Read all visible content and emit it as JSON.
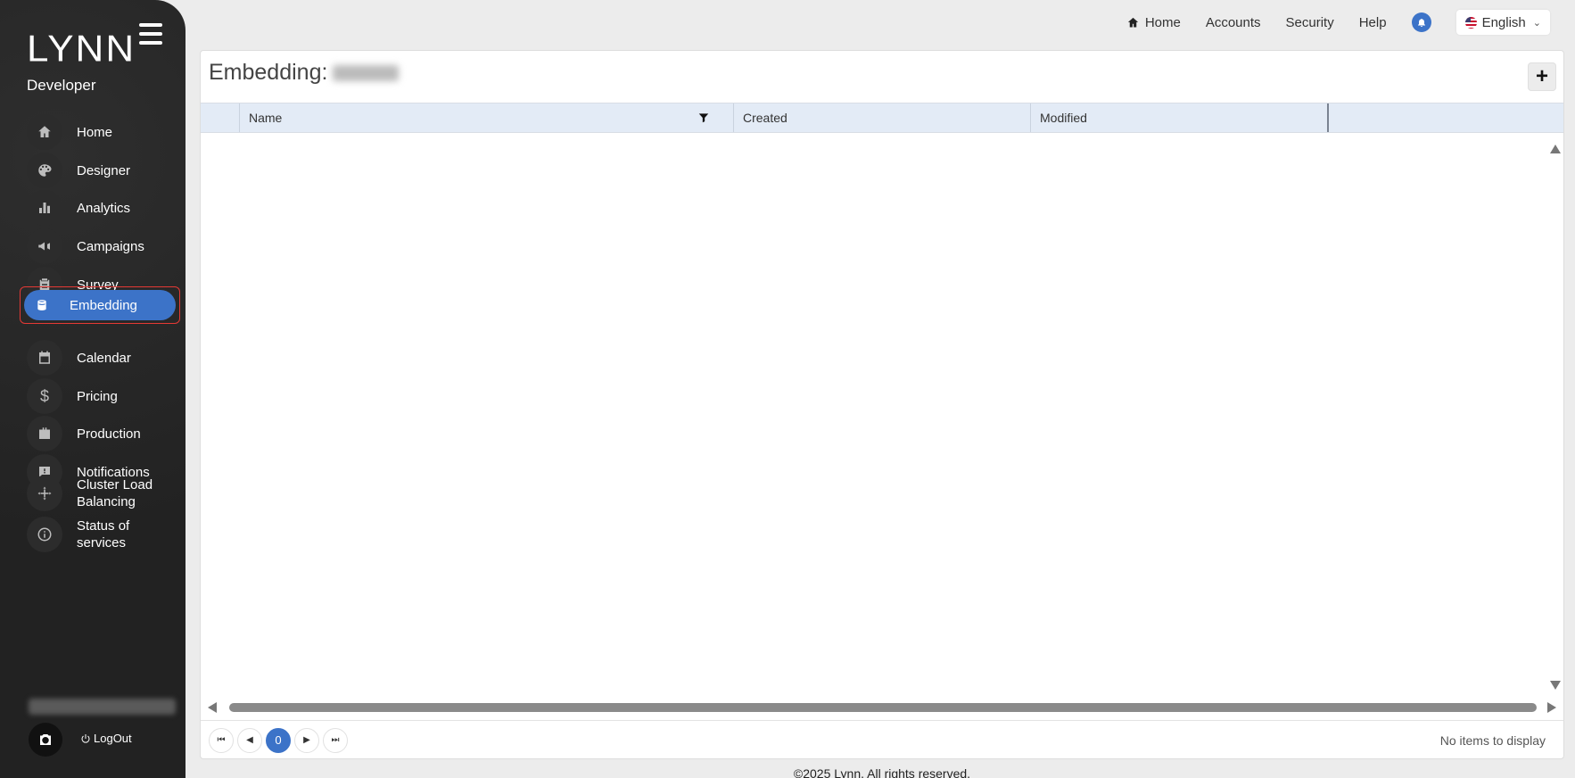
{
  "app": {
    "brand": "LYNN",
    "role": "Developer"
  },
  "sidebar": {
    "items": [
      {
        "label": "Home",
        "icon": "home-icon"
      },
      {
        "label": "Designer",
        "icon": "palette-icon"
      },
      {
        "label": "Analytics",
        "icon": "bar-chart-icon"
      },
      {
        "label": "Campaigns",
        "icon": "megaphone-icon"
      },
      {
        "label": "Survey",
        "icon": "clipboard-icon"
      },
      {
        "label": "Embedding",
        "icon": "database-icon",
        "active": true
      },
      {
        "label": "Calendar",
        "icon": "calendar-icon"
      },
      {
        "label": "Pricing",
        "icon": "dollar-icon"
      },
      {
        "label": "Production",
        "icon": "briefcase-icon"
      },
      {
        "label": "Notifications",
        "icon": "chat-alert-icon"
      },
      {
        "label": "Cluster Load Balancing",
        "icon": "cluster-icon"
      },
      {
        "label": "Status of services",
        "icon": "info-icon"
      }
    ],
    "logout_label": "LogOut"
  },
  "topnav": {
    "home": "Home",
    "accounts": "Accounts",
    "security": "Security",
    "help": "Help",
    "language": "English"
  },
  "main": {
    "title_prefix": "Embedding:",
    "add_label": "+",
    "columns": [
      "Name",
      "Created",
      "Modified"
    ],
    "pager": {
      "current_page": "0",
      "status": "No items to display"
    }
  },
  "footer": {
    "text": "©2025 Lynn. All rights reserved."
  },
  "colors": {
    "accent": "#3c73c8",
    "sidebar_bg": "#232323",
    "active_border": "#e53935"
  }
}
